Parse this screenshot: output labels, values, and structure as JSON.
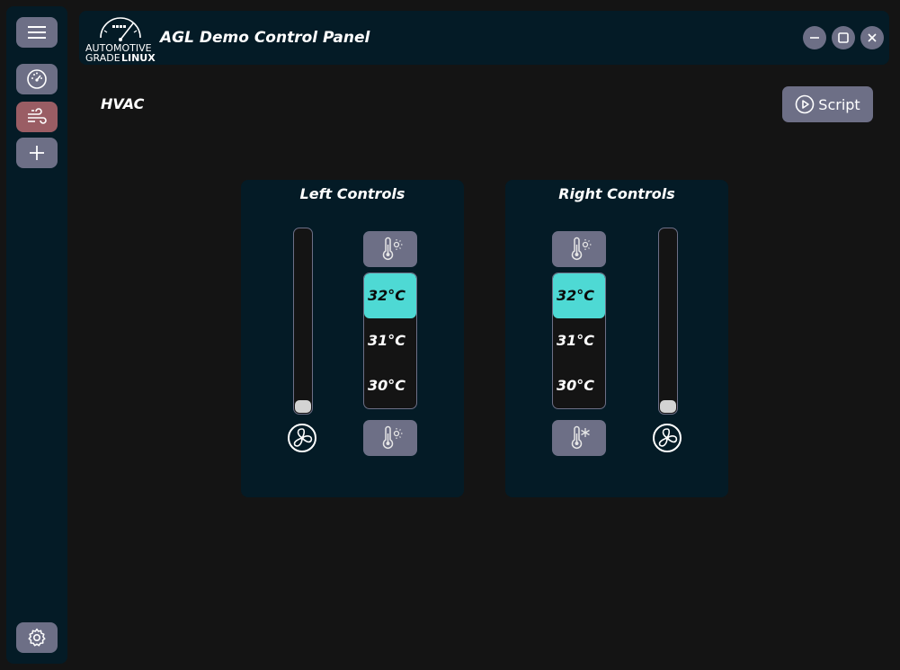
{
  "app": {
    "title": "AGL Demo Control Panel",
    "logo_text_line1": "AUTOMOTIVE",
    "logo_text_line2a": "GRADE",
    "logo_text_line2b": "LINUX"
  },
  "sidebar": {
    "items": [
      {
        "icon": "hamburger-menu-icon"
      },
      {
        "icon": "dashboard-gauge-icon"
      },
      {
        "icon": "wind-icon",
        "active": true
      },
      {
        "icon": "plus-icon"
      },
      {
        "icon": "gear-icon"
      }
    ],
    "active_color": "#9a5d64"
  },
  "window_controls": [
    "minimize-icon",
    "maximize-icon",
    "close-icon"
  ],
  "page": {
    "title": "HVAC",
    "script_label": "Script"
  },
  "left_controls": {
    "title": "Left Controls",
    "fan_level": 0,
    "temperatures": [
      "32°C",
      "31°C",
      "30°C"
    ],
    "selected_temperature": "32°C",
    "top_button_icon": "thermometer-sun-icon",
    "bottom_button_icon": "thermometer-sun-icon"
  },
  "right_controls": {
    "title": "Right Controls",
    "fan_level": 0,
    "temperatures": [
      "32°C",
      "31°C",
      "30°C"
    ],
    "selected_temperature": "32°C",
    "top_button_icon": "thermometer-sun-icon",
    "bottom_button_icon": "thermometer-snowflake-icon"
  },
  "colors": {
    "panel_bg": "#041b26",
    "button_bg": "#6d6f86",
    "selected_temp": "#4ed9d4"
  }
}
